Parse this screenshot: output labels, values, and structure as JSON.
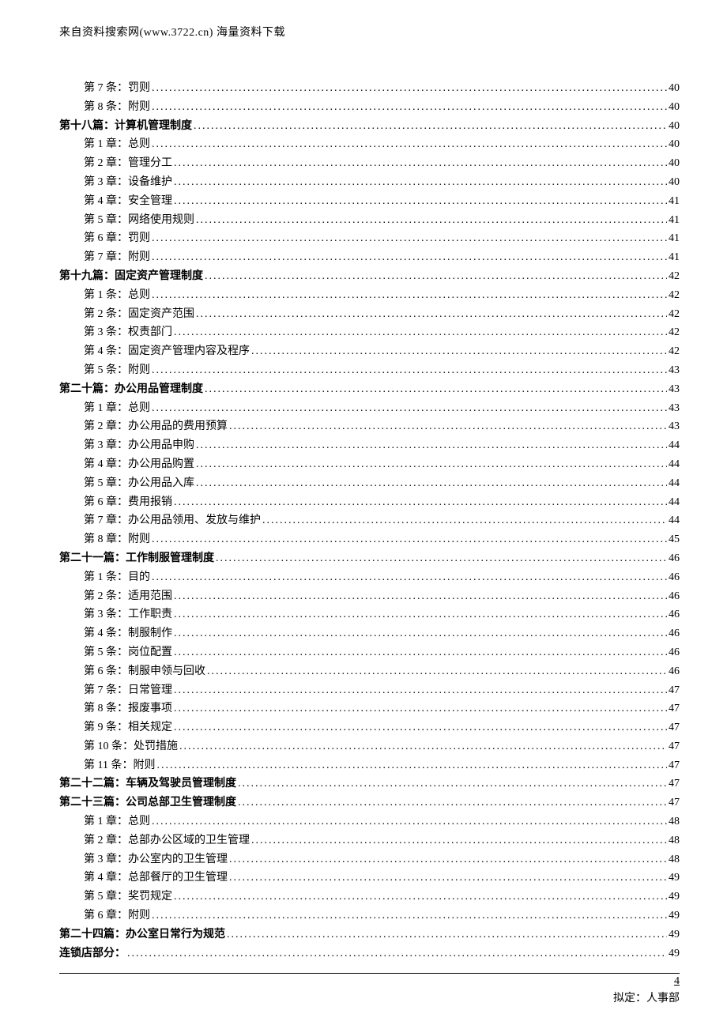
{
  "header": "来自资料搜索网(www.3722.cn) 海量资料下载",
  "footer": {
    "page": "4",
    "text": "拟定：人事部"
  },
  "toc": [
    {
      "level": 2,
      "label": "第 7 条：罚则",
      "page": "40"
    },
    {
      "level": 2,
      "label": "第 8 条：附则",
      "page": "40"
    },
    {
      "level": 1,
      "label": "第十八篇：计算机管理制度 ",
      "page": "40"
    },
    {
      "level": 2,
      "label": "第 1 章：总则",
      "page": "40"
    },
    {
      "level": 2,
      "label": "第 2 章：管理分工",
      "page": "40"
    },
    {
      "level": 2,
      "label": "第 3 章：设备维护",
      "page": "40"
    },
    {
      "level": 2,
      "label": "第 4 章：安全管理",
      "page": "41"
    },
    {
      "level": 2,
      "label": "第 5 章：网络使用规则",
      "page": "41"
    },
    {
      "level": 2,
      "label": "第 6 章：罚则",
      "page": "41"
    },
    {
      "level": 2,
      "label": "第 7 章：附则",
      "page": "41"
    },
    {
      "level": 1,
      "label": "第十九篇：固定资产管理制度 ",
      "page": "42"
    },
    {
      "level": 2,
      "label": "第 1 条：总则",
      "page": "42"
    },
    {
      "level": 2,
      "label": "第 2 条：固定资产范围",
      "page": "42"
    },
    {
      "level": 2,
      "label": "第 3 条：权责部门",
      "page": "42"
    },
    {
      "level": 2,
      "label": "第 4 条：固定资产管理内容及程序",
      "page": "42"
    },
    {
      "level": 2,
      "label": "第 5 条：附则",
      "page": "43"
    },
    {
      "level": 1,
      "label": "第二十篇：办公用品管理制度 ",
      "page": "43"
    },
    {
      "level": 2,
      "label": "第 1 章：总则",
      "page": "43"
    },
    {
      "level": 2,
      "label": "第 2 章：办公用品的费用预算",
      "page": "43"
    },
    {
      "level": 2,
      "label": "第 3 章：办公用品申购",
      "page": "44"
    },
    {
      "level": 2,
      "label": "第 4 章：办公用品购置",
      "page": "44"
    },
    {
      "level": 2,
      "label": "第 5 章：办公用品入库",
      "page": "44"
    },
    {
      "level": 2,
      "label": "第 6 章：费用报销",
      "page": "44"
    },
    {
      "level": 2,
      "label": "第 7 章：办公用品领用、发放与维护",
      "page": "44"
    },
    {
      "level": 2,
      "label": "第 8 章：附则",
      "page": "45"
    },
    {
      "level": 1,
      "label": "第二十一篇：工作制服管理制度 ",
      "page": "46"
    },
    {
      "level": 2,
      "label": "第 1 条：目的",
      "page": "46"
    },
    {
      "level": 2,
      "label": "第 2 条：适用范围",
      "page": "46"
    },
    {
      "level": 2,
      "label": "第 3 条：工作职责",
      "page": "46"
    },
    {
      "level": 2,
      "label": "第 4 条：制服制作",
      "page": "46"
    },
    {
      "level": 2,
      "label": "第 5 条：岗位配置",
      "page": "46"
    },
    {
      "level": 2,
      "label": "第 6 条：制服申领与回收",
      "page": "46"
    },
    {
      "level": 2,
      "label": "第 7 条：日常管理",
      "page": "47"
    },
    {
      "level": 2,
      "label": "第 8 条：报废事项",
      "page": "47"
    },
    {
      "level": 2,
      "label": "第 9 条：相关规定",
      "page": "47"
    },
    {
      "level": 2,
      "label": "第 10 条：处罚措施",
      "page": "47"
    },
    {
      "level": 2,
      "label": "第 11 条：附则",
      "page": "47"
    },
    {
      "level": 1,
      "label": "第二十二篇：车辆及驾驶员管理制度 ",
      "page": "47"
    },
    {
      "level": 1,
      "label": "第二十三篇：公司总部卫生管理制度 ",
      "page": "47"
    },
    {
      "level": 2,
      "label": "第 1 章：总则",
      "page": "48"
    },
    {
      "level": 2,
      "label": "第 2 章：总部办公区域的卫生管理",
      "page": "48"
    },
    {
      "level": 2,
      "label": "第 3 章：办公室内的卫生管理",
      "page": "48"
    },
    {
      "level": 2,
      "label": "第 4 章：总部餐厅的卫生管理",
      "page": "49"
    },
    {
      "level": 2,
      "label": "第 5 章：奖罚规定",
      "page": "49"
    },
    {
      "level": 2,
      "label": "第 6 章：附则",
      "page": "49"
    },
    {
      "level": 1,
      "label": "第二十四篇：办公室日常行为规范 ",
      "page": "49"
    },
    {
      "level": 1,
      "label": "连锁店部分： ",
      "page": "49"
    }
  ]
}
